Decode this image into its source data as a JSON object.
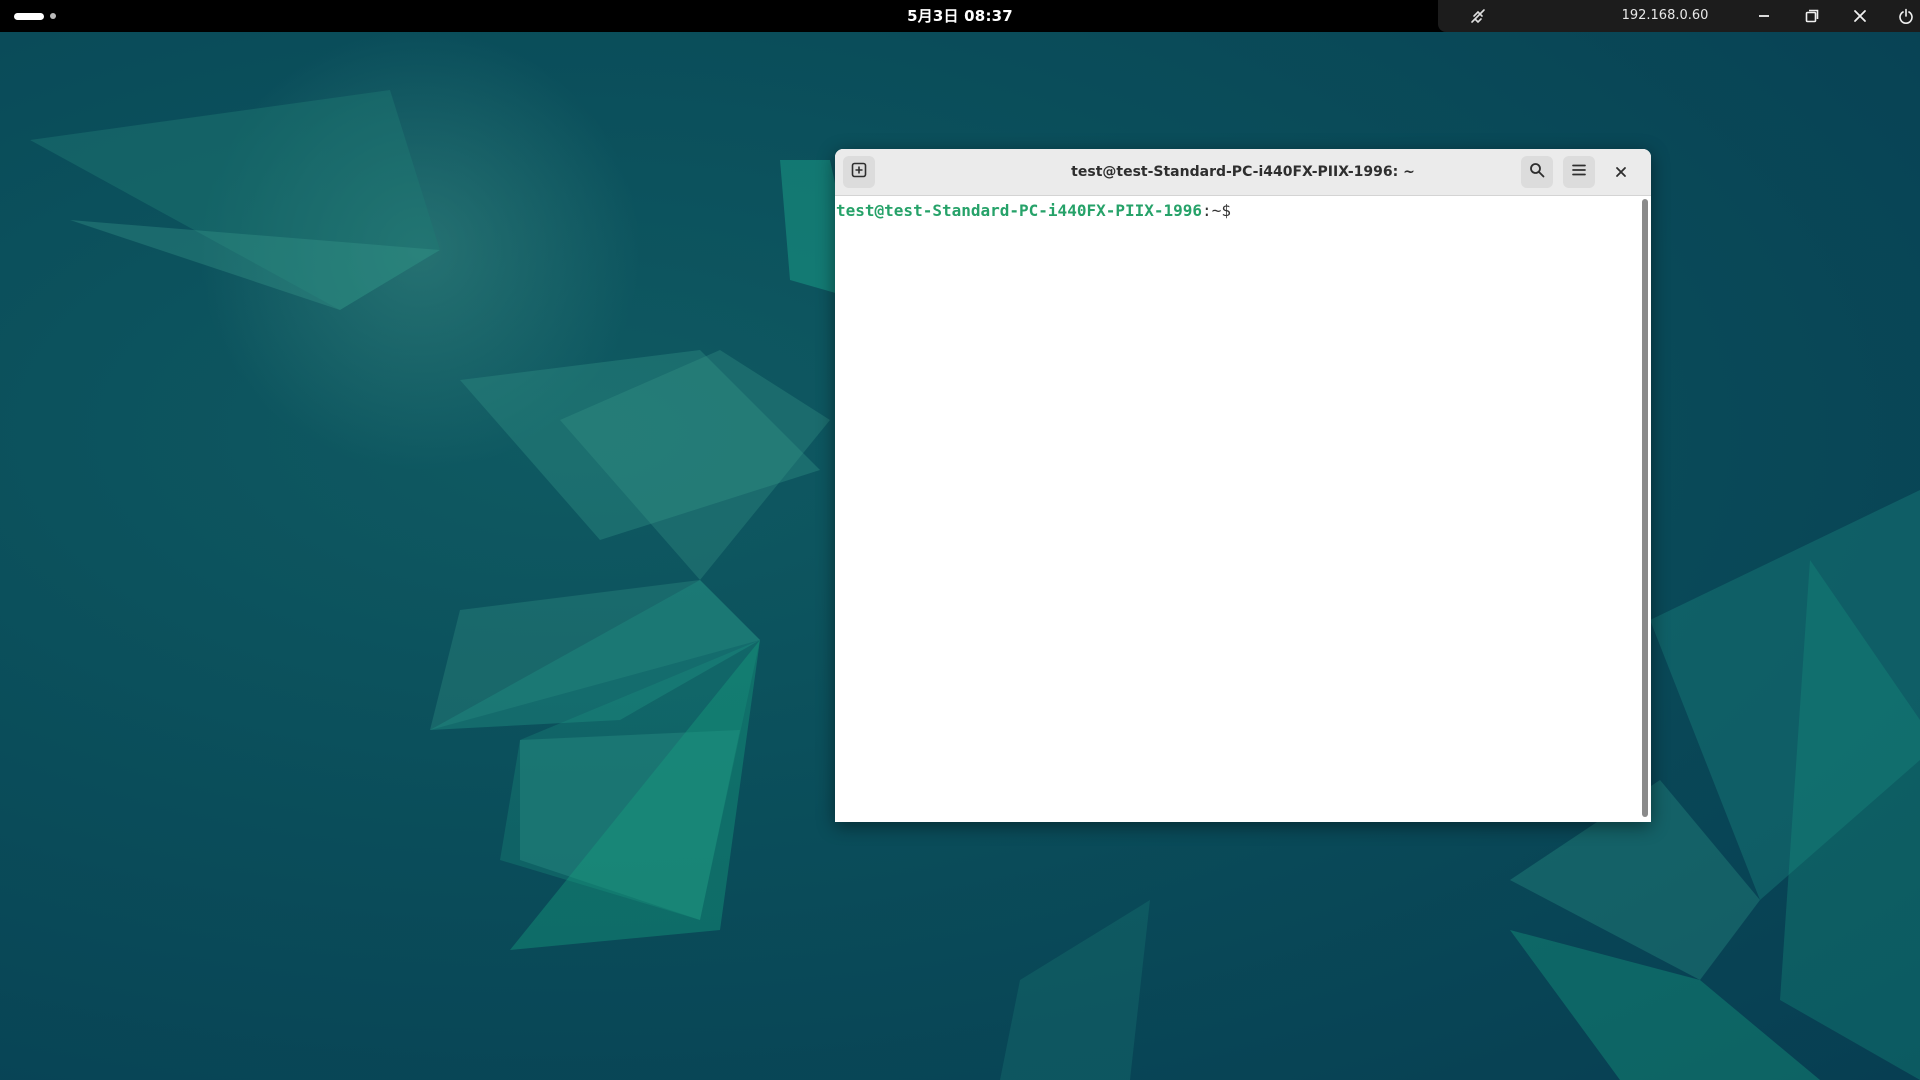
{
  "topbar": {
    "clock": "5月3日 08:37",
    "ip_address": "192.168.0.60"
  },
  "remote_controls": {
    "icons": [
      "disconnect-icon",
      "minimize-icon",
      "restore-icon",
      "close-icon",
      "power-icon"
    ]
  },
  "terminal": {
    "title": "test@test-Standard-PC-i440FX-PIIX-1996: ~",
    "prompt_user_host": "test@test-Standard-PC-i440FX-PIIX-1996",
    "prompt_separator": ":",
    "prompt_path": "~$",
    "header_icons": [
      "new-tab-icon",
      "search-icon",
      "menu-icon",
      "close-icon"
    ]
  },
  "colors": {
    "prompt_green": "#26a269",
    "desktop_teal": "#0a4d5a",
    "topbar_black": "#000000"
  }
}
